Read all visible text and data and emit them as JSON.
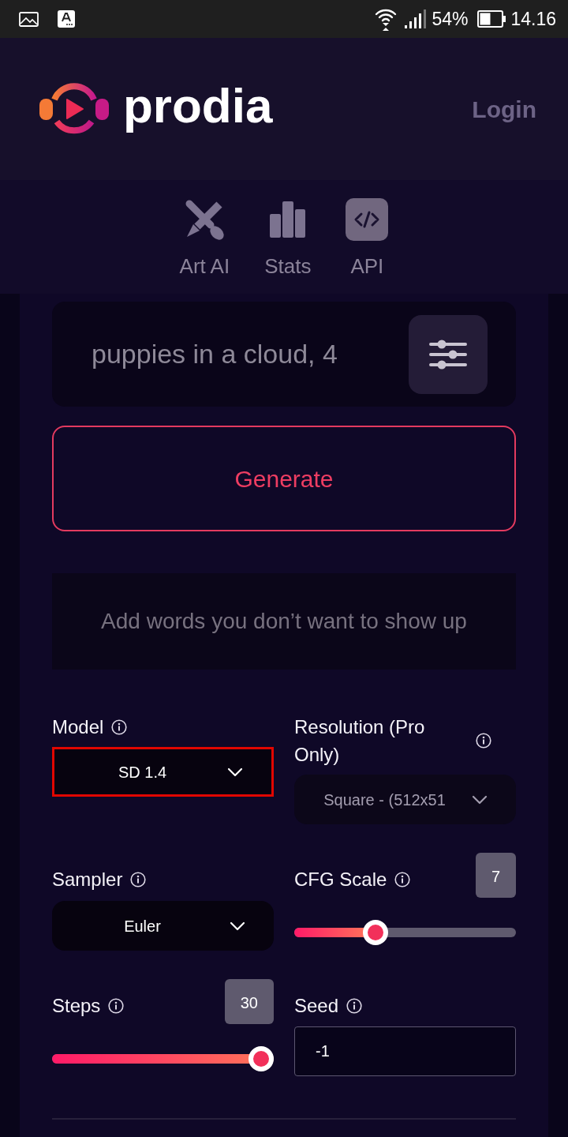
{
  "status_bar": {
    "battery": "54%",
    "time": "14.16"
  },
  "header": {
    "brand": "prodia",
    "login": "Login"
  },
  "nav_tabs": [
    {
      "label": "Art AI"
    },
    {
      "label": "Stats"
    },
    {
      "label": "API"
    }
  ],
  "prompt": {
    "placeholder": "puppies in a cloud, 4"
  },
  "generate_button": {
    "label": "Generate"
  },
  "negative_prompt": {
    "placeholder": "Add words you don’t want to show up"
  },
  "settings": [
    {
      "kind": "select",
      "label": "Model",
      "value": "SD 1.4",
      "highlighted": true,
      "disabled": false
    },
    {
      "kind": "select",
      "label": "Resolution (Pro Only)",
      "value": "Square - (512x51",
      "highlighted": false,
      "disabled": true
    },
    {
      "kind": "select",
      "label": "Sampler",
      "value": "Euler",
      "highlighted": false,
      "disabled": false
    },
    {
      "kind": "slider",
      "label": "CFG Scale",
      "value": "7",
      "level": 0.35,
      "highlighted": false,
      "disabled": false
    },
    {
      "kind": "slider",
      "label": "Steps",
      "value": "30",
      "level": 1,
      "highlighted": false,
      "disabled": false
    },
    {
      "kind": "input",
      "label": "Seed",
      "value": "-1",
      "highlighted": false,
      "disabled": false
    }
  ]
}
